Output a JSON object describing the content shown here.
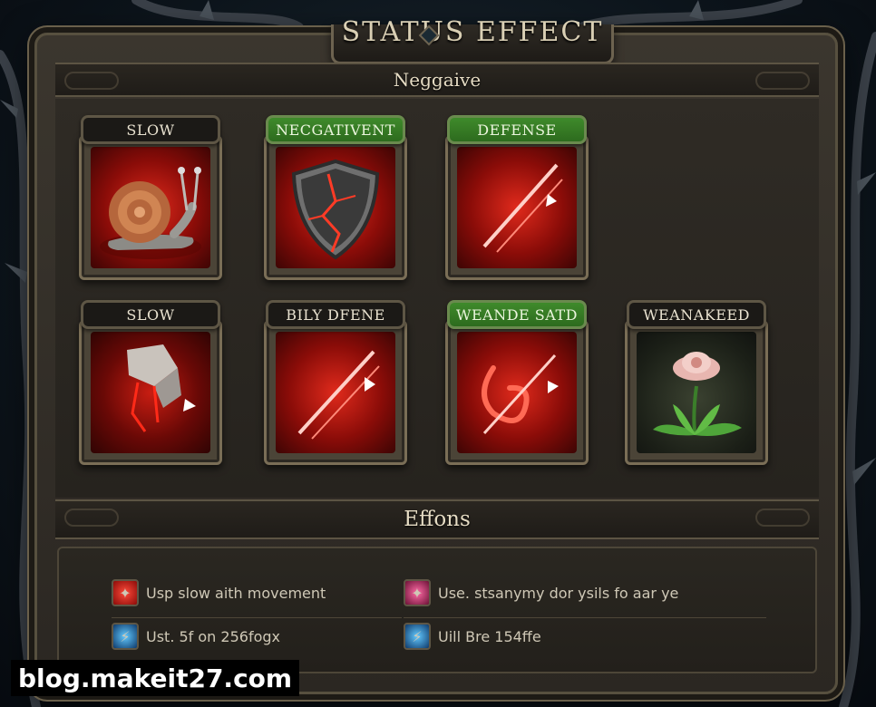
{
  "window": {
    "title": "STATUS EFFECT"
  },
  "sections": {
    "top_label": "Neggaive",
    "bottom_label": "Effons"
  },
  "cards": [
    {
      "label": "SLOW",
      "label_style": "dark",
      "icon": "snail-icon"
    },
    {
      "label": "NECGATIVENT",
      "label_style": "green",
      "icon": "cracked-shield-icon"
    },
    {
      "label": "DEFENSE",
      "label_style": "green",
      "icon": "red-slash-icon"
    },
    {
      "label": "SLOW",
      "label_style": "dark",
      "icon": "shattered-stone-icon"
    },
    {
      "label": "BILY DFENE",
      "label_style": "dark",
      "icon": "red-slash-icon"
    },
    {
      "label": "WEANDE SATD",
      "label_style": "green",
      "icon": "red-swirl-slash-icon"
    },
    {
      "label": "WEANAKEED",
      "label_style": "dark",
      "icon": "flower-icon"
    }
  ],
  "effects": [
    {
      "text": "Usp  slow  aith movement",
      "icon": "red-burst-icon",
      "color": "#e02a1c"
    },
    {
      "text": "Use. stsanymy  dor  ysils  fo  aar  ye",
      "icon": "pink-burst-icon",
      "color": "#d63a7a"
    },
    {
      "text": "Ust.  5f  on 256fogx",
      "icon": "blue-lightning-icon",
      "color": "#3aa6e0"
    },
    {
      "text": "Uill  Bre  154ffe",
      "icon": "blue-lightning-icon",
      "color": "#3aa6e0"
    }
  ],
  "watermark": "blog.makeit27.com",
  "colors": {
    "frame": "#3b362e",
    "accent_green": "#3f8a2b",
    "accent_red": "#e02a1c"
  }
}
